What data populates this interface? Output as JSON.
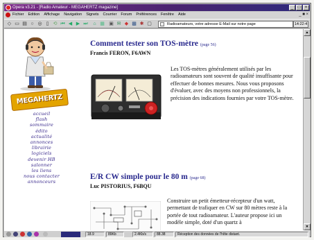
{
  "window": {
    "title": "Opera v3.21 - [Radio Amateur - MEGAHERTZ magazine]",
    "controls": [
      "_",
      "□",
      "×"
    ]
  },
  "menubar": {
    "items": [
      "Fichier",
      "Edition",
      "Affichage",
      "Navigation",
      "Signets",
      "Courrier",
      "Forum",
      "Préférences",
      "Fenêtre",
      "Aide"
    ],
    "mdi_controls": "_ ■ ×"
  },
  "toolbar": {
    "address": "Radioamateurs, votre adresse E-Mail sur notre page",
    "clock": "14:22:4"
  },
  "sidebar": {
    "logo_text": "MEGAHERTZ",
    "nav": [
      "accueil",
      "flash",
      "sommaire",
      "édito",
      "actualité",
      "annonces",
      "librairie",
      "logiciels",
      "devenir HB",
      "salonner",
      "les liens",
      "nous contacter",
      "annonceurs"
    ]
  },
  "articles": [
    {
      "title": "Comment tester son TOS-mètre",
      "page": "(page 56)",
      "author": "Francis FERON, F6AWN",
      "text": "Les TOS-mètres généralement utilisés par les radioamateurs sont souvent de qualité insuffisante pour effectuer de bonnes mesures. Nous vous proposons d'évaluer, avec des moyens non professionnels, la précision des indications fournies par votre TOS-mètre."
    },
    {
      "title": "E/R CW simple pour le 80 m",
      "page": "(page 68)",
      "author": "Luc PISTORIUS, F6BQU",
      "text": "Construire un petit émetteur-récepteur d'un watt, permettant de trafiquer en CW sur 80 mètres reste à la portée de tout radioamateur. L'auteur propose ici un modèle simple, doté d'un quartz à"
    }
  ],
  "statusbar": {
    "cells": [
      "18.9",
      "89Kb",
      "2.4Kb/s",
      "88.38",
      "Réception des données de l'hôte distant."
    ]
  },
  "colors": {
    "title_accent": "#2a2a8e",
    "nav_text": "#3a2a8c",
    "logo_bg": "#e3a400"
  }
}
